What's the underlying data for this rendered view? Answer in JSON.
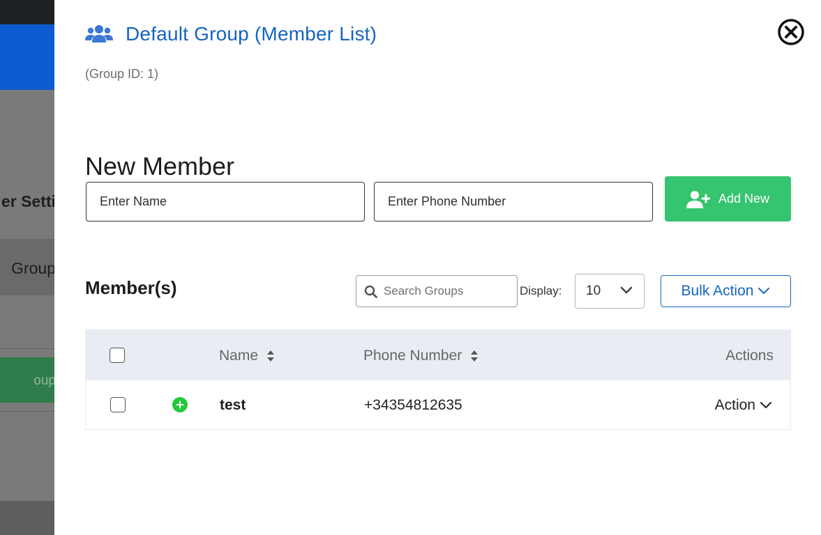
{
  "background": {
    "text_settings": "er Setti",
    "text_group": "Group",
    "text_button": "oup"
  },
  "drawer": {
    "title": "Default Group (Member List)",
    "group_id": "(Group ID: 1)"
  },
  "new_member": {
    "title": "New Member",
    "name_placeholder": "Enter Name",
    "phone_placeholder": "Enter Phone Number",
    "add_label": "Add New"
  },
  "members": {
    "title": "Member(s)",
    "search_placeholder": "Search Groups",
    "display_label": "Display:",
    "display_value": "10",
    "bulk_action_label": "Bulk Action"
  },
  "table": {
    "columns": [
      "Name",
      "Phone Number",
      "Actions"
    ],
    "rows": [
      {
        "name": "test",
        "phone": "+34354812635",
        "action": "Action"
      }
    ]
  },
  "colors": {
    "accent": "#1565c0",
    "add_button": "#35c46f",
    "status_green": "#22c93c"
  },
  "icons": [
    "users-icon",
    "close-circle-icon",
    "user-plus-icon",
    "search-icon",
    "chevron-down-icon",
    "sort-icon",
    "plus-circle-icon"
  ]
}
